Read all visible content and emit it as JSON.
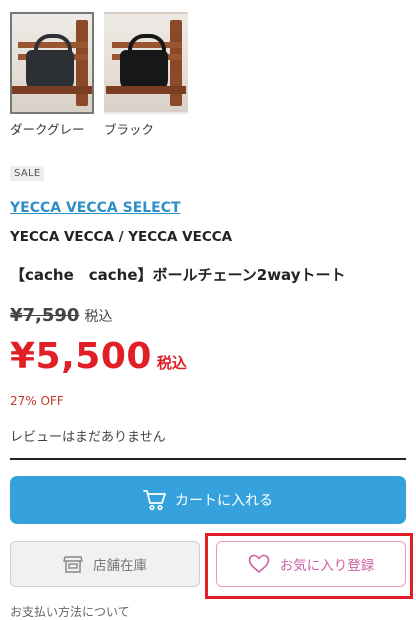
{
  "swatches": [
    {
      "label": "ダークグレー",
      "selected": true
    },
    {
      "label": "ブラック",
      "selected": false
    }
  ],
  "badge": "SALE",
  "brand_link": "YECCA VECCA SELECT",
  "brand_name": "YECCA VECCA / YECCA VECCA",
  "product_title": "【cache　cache】ボールチェーン2wayトート",
  "price": {
    "original": "¥7,590",
    "original_tax": "税込",
    "sale": "¥5,500",
    "sale_tax": "税込",
    "discount": "27% OFF"
  },
  "reviews_text": "レビューはまだありません",
  "buttons": {
    "cart": "カートに入れる",
    "store_stock": "店舗在庫",
    "favorite": "お気に入り登録"
  },
  "footer_partial": "お支払い方法について",
  "colors": {
    "accent_blue": "#35a2de",
    "sale_red": "#e01f26",
    "favorite_pink": "#d15fa0",
    "link_blue": "#2f8fc9"
  },
  "icons": [
    "cart-icon",
    "store-icon",
    "heart-icon"
  ]
}
